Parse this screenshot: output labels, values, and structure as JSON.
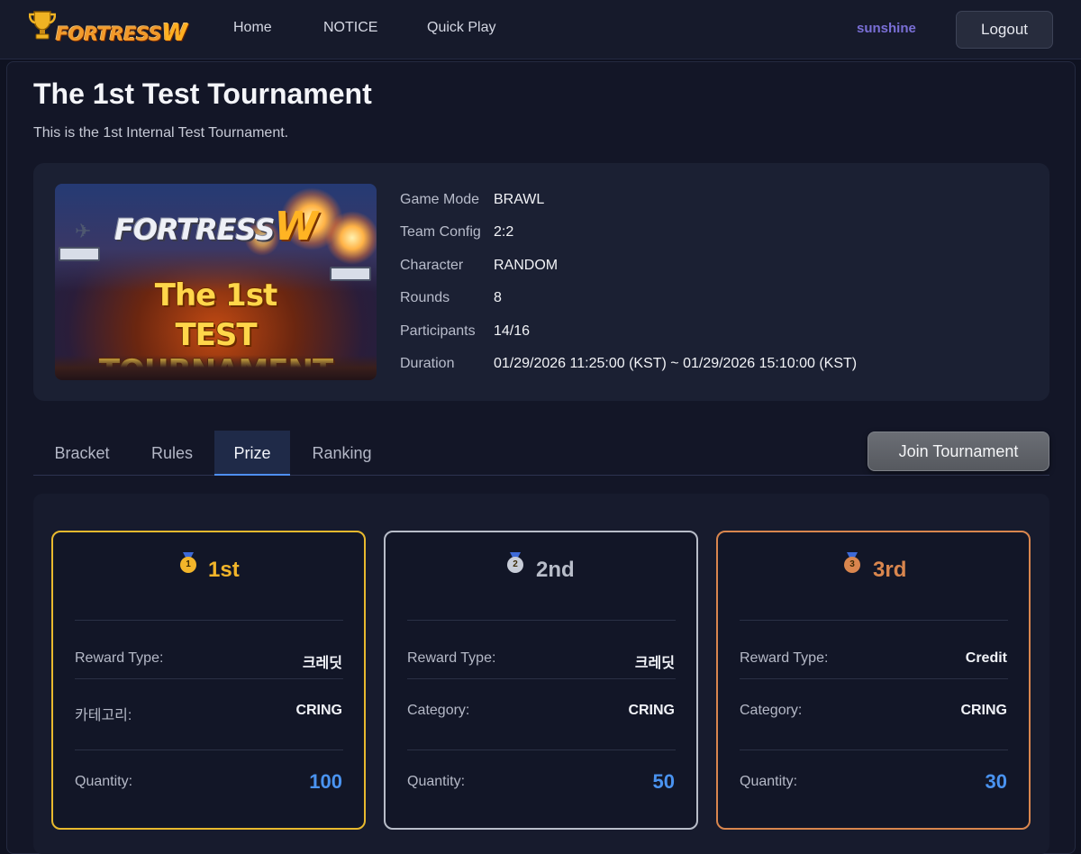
{
  "nav": {
    "logo_text": "FORTRESS",
    "logo_w": "W",
    "links": [
      "Home",
      "NOTICE",
      "Quick Play"
    ],
    "username": "sunshine",
    "logout_label": "Logout"
  },
  "tournament": {
    "title": "The 1st Test Tournament",
    "subtitle": "This is the 1st Internal Test Tournament.",
    "banner": {
      "logo_text": "FORTRESS",
      "logo_w": "W",
      "line1": "The 1st",
      "line2": "TEST TOURNAMENT"
    },
    "info": [
      {
        "label": "Game Mode",
        "value": "BRAWL"
      },
      {
        "label": "Team Config",
        "value": "2:2"
      },
      {
        "label": "Character",
        "value": "RANDOM"
      },
      {
        "label": "Rounds",
        "value": "8"
      },
      {
        "label": "Participants",
        "value": "14/16"
      },
      {
        "label": "Duration",
        "value": "01/29/2026 11:25:00 (KST) ~ 01/29/2026 15:10:00 (KST)"
      }
    ]
  },
  "tabs": {
    "items": [
      "Bracket",
      "Rules",
      "Prize",
      "Ranking"
    ],
    "active": "Prize",
    "join_label": "Join Tournament"
  },
  "prizes": [
    {
      "place": "1st",
      "medal_num": "1",
      "color": "#e8b92e",
      "rows": [
        {
          "label": "Reward Type:",
          "value": "크레딧"
        },
        {
          "label": "카테고리:",
          "value": "CRING"
        }
      ],
      "quantity_label": "Quantity:",
      "quantity": "100"
    },
    {
      "place": "2nd",
      "medal_num": "2",
      "color": "#b8bdc9",
      "rows": [
        {
          "label": "Reward Type:",
          "value": "크레딧"
        },
        {
          "label": "Category:",
          "value": "CRING"
        }
      ],
      "quantity_label": "Quantity:",
      "quantity": "50"
    },
    {
      "place": "3rd",
      "medal_num": "3",
      "color": "#d9864e",
      "rows": [
        {
          "label": "Reward Type:",
          "value": "Credit"
        },
        {
          "label": "Category:",
          "value": "CRING"
        }
      ],
      "quantity_label": "Quantity:",
      "quantity": "30"
    }
  ]
}
